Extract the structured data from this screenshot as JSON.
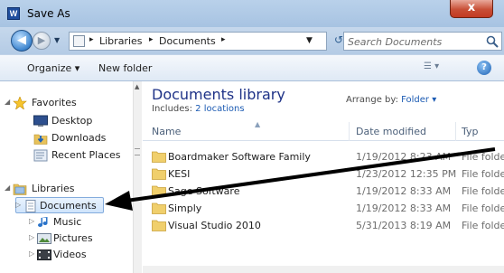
{
  "window": {
    "title": "Save As",
    "app_icon_letter": "W",
    "close_label": "x"
  },
  "address": {
    "breadcrumb": [
      "Libraries",
      "Documents"
    ],
    "search_placeholder": "Search Documents"
  },
  "toolbar": {
    "organize_label": "Organize ▾",
    "new_folder_label": "New folder"
  },
  "navigation": {
    "favorites": {
      "label": "Favorites",
      "items": [
        {
          "label": "Desktop",
          "icon": "desktop-icon"
        },
        {
          "label": "Downloads",
          "icon": "downloads-icon"
        },
        {
          "label": "Recent Places",
          "icon": "recent-places-icon"
        }
      ]
    },
    "libraries": {
      "label": "Libraries",
      "items": [
        {
          "label": "Documents",
          "icon": "documents-library-icon",
          "selected": true
        },
        {
          "label": "Music",
          "icon": "music-library-icon"
        },
        {
          "label": "Pictures",
          "icon": "pictures-library-icon"
        },
        {
          "label": "Videos",
          "icon": "videos-library-icon"
        }
      ]
    }
  },
  "library": {
    "title": "Documents library",
    "includes_label": "Includes:",
    "includes_link": "2 locations",
    "arrange_label": "Arrange by:",
    "arrange_value": "Folder ▾"
  },
  "columns": {
    "name": "Name",
    "date": "Date modified",
    "type": "Typ"
  },
  "files": [
    {
      "name": "Boardmaker Software Family",
      "date": "1/19/2012 8:23 AM",
      "type": "File folder"
    },
    {
      "name": "KESI",
      "date": "1/23/2012 12:35 PM",
      "type": "File folder"
    },
    {
      "name": "Sage Software",
      "date": "1/19/2012 8:33 AM",
      "type": "File folder"
    },
    {
      "name": "Simply",
      "date": "1/19/2012 8:33 AM",
      "type": "File folder"
    },
    {
      "name": "Visual Studio 2010",
      "date": "5/31/2013 8:19 AM",
      "type": "File folder"
    }
  ],
  "colors": {
    "title_bar": "#b9d1ea",
    "library_title": "#1e3287",
    "link": "#1c5bb3",
    "selection_border": "#84acdd",
    "arrow": "#000000"
  }
}
